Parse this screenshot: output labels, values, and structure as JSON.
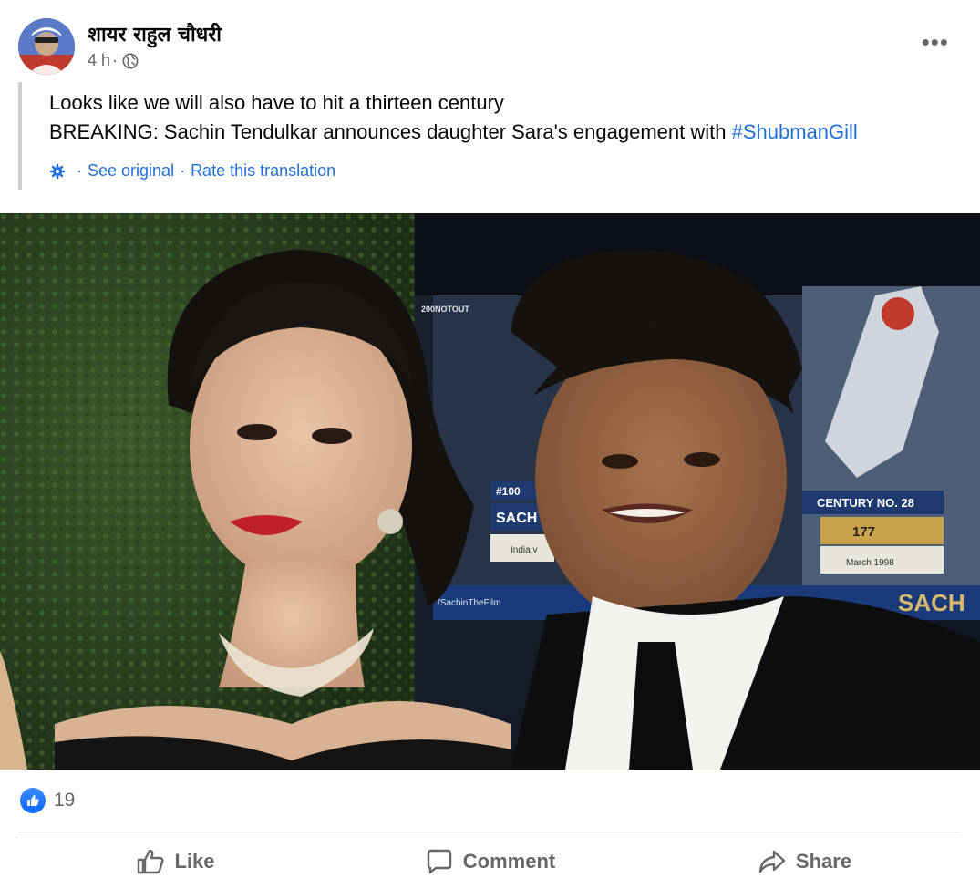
{
  "post": {
    "author": "शायर राहुल चौधरी",
    "time": "4 h",
    "time_separator": "·",
    "more_label": "•••",
    "text_line1": "Looks like we will also have to hit a thirteen century",
    "text_line2_prefix": "BREAKING: Sachin Tendulkar announces daughter Sara's engagement with ",
    "hashtag": "#ShubmanGill",
    "translation": {
      "see_original": "See original",
      "rate": "Rate this translation",
      "separator": "·"
    },
    "photo": {
      "screen_label_1": "#100",
      "screen_label_2": "SACH",
      "screen_label_3": "India v",
      "screen_label_4": "CENTURY NO. 28",
      "screen_label_5": "177",
      "screen_label_6": "March 1998",
      "screen_label_7": "SACH",
      "screen_label_8": "/SachinTheFilm",
      "screen_label_9": "200NOTOUT"
    },
    "reactions": {
      "count": "19"
    },
    "actions": {
      "like": "Like",
      "comment": "Comment",
      "share": "Share"
    }
  }
}
